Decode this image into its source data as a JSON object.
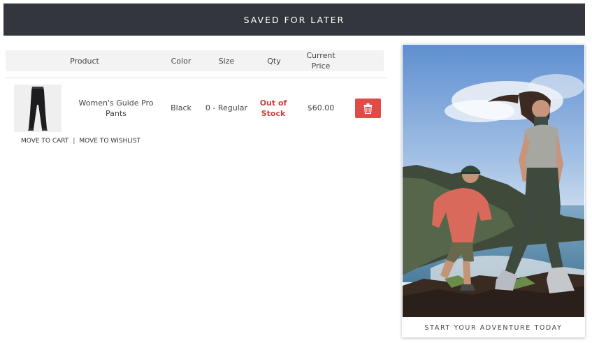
{
  "header": {
    "title": "SAVED FOR LATER"
  },
  "table": {
    "columns": {
      "product": "Product",
      "color": "Color",
      "size": "Size",
      "qty": "Qty",
      "price_line1": "Current",
      "price_line2": "Price"
    },
    "rows": [
      {
        "image_icon": "pants-thumbnail",
        "product_line1": "Women's Guide Pro",
        "product_line2": "Pants",
        "color": "Black",
        "size": "0 - Regular",
        "qty_line1": "Out of",
        "qty_line2": "Stock",
        "price": "$60.00",
        "delete_icon": "trash-icon",
        "move_to_cart": "MOVE TO CART",
        "separator": "|",
        "move_to_wishlist": "MOVE TO WISHLIST"
      }
    ]
  },
  "promo": {
    "caption": "START YOUR ADVENTURE TODAY"
  },
  "colors": {
    "header_bg": "#33373d",
    "stock_red": "#c9413b",
    "delete_red": "#de4c48"
  }
}
